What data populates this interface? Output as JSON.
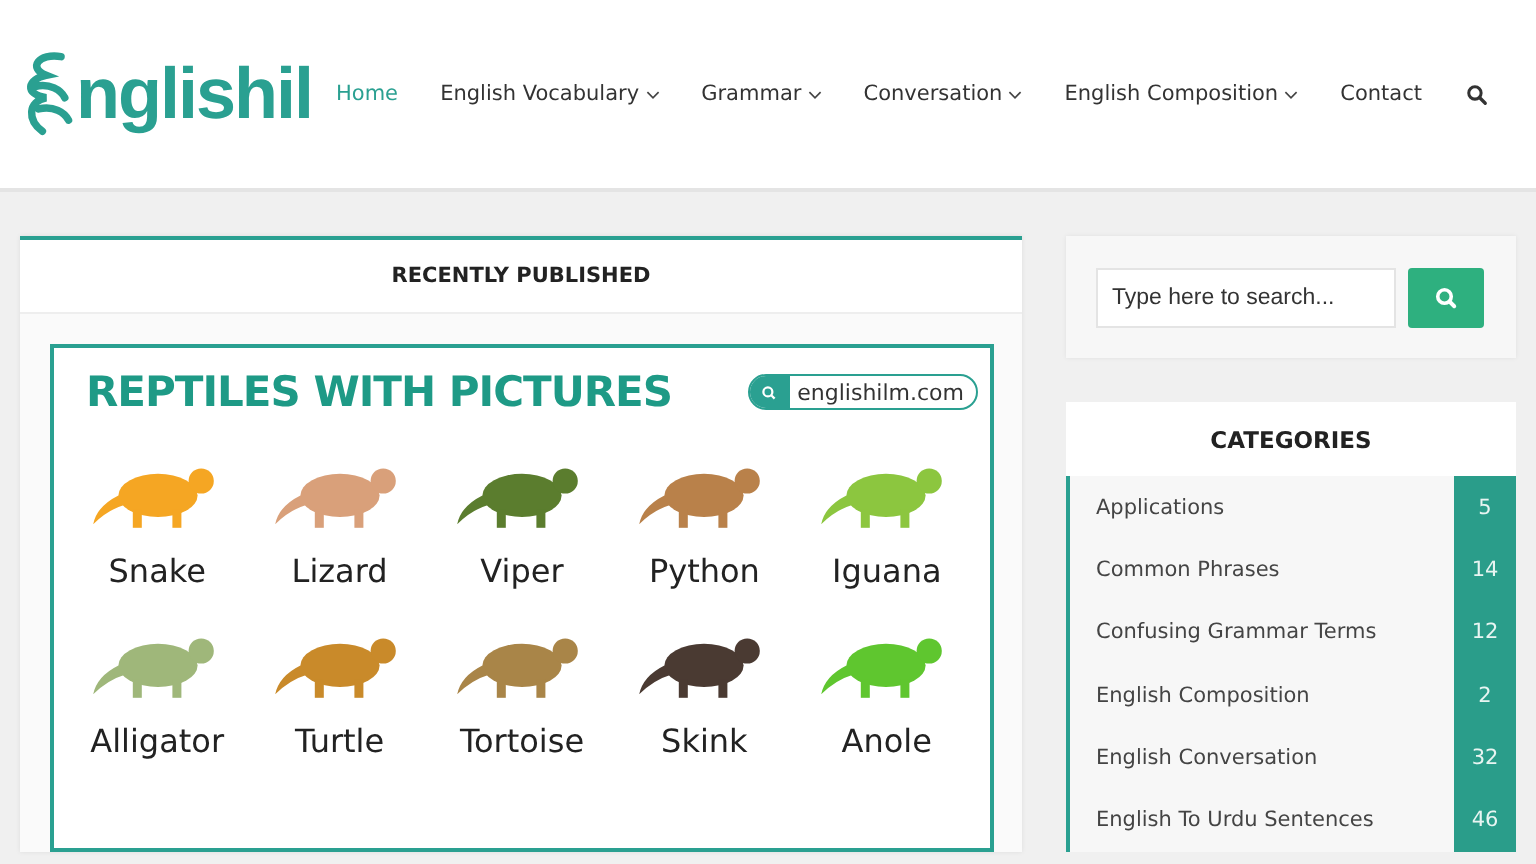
{
  "header": {
    "logo_text": "nglishil",
    "nav": [
      {
        "label": "Home",
        "selected": true,
        "dropdown": false
      },
      {
        "label": "English Vocabulary",
        "selected": false,
        "dropdown": true
      },
      {
        "label": "Grammar",
        "selected": false,
        "dropdown": true
      },
      {
        "label": "Conversation",
        "selected": false,
        "dropdown": true
      },
      {
        "label": "English Composition",
        "selected": false,
        "dropdown": true
      },
      {
        "label": "Contact",
        "selected": false,
        "dropdown": false
      }
    ]
  },
  "main": {
    "title": "RECENTLY PUBLISHED",
    "featured_image": {
      "title": "REPTILES WITH PICTURES",
      "site": "englishilm.com",
      "animals": [
        {
          "label": "Snake",
          "color": "#f5a623"
        },
        {
          "label": "Lizard",
          "color": "#d9a07a"
        },
        {
          "label": "Viper",
          "color": "#5b7d2e"
        },
        {
          "label": "Python",
          "color": "#b9814a"
        },
        {
          "label": "Iguana",
          "color": "#8cc63f"
        },
        {
          "label": "Alligator",
          "color": "#9fb77a"
        },
        {
          "label": "Turtle",
          "color": "#c98a2a"
        },
        {
          "label": "Tortoise",
          "color": "#a98548"
        },
        {
          "label": "Skink",
          "color": "#4a3a32"
        },
        {
          "label": "Anole",
          "color": "#5fc62f"
        }
      ]
    }
  },
  "sidebar": {
    "search": {
      "placeholder": "Type here to search..."
    },
    "categories": {
      "title": "CATEGORIES",
      "items": [
        {
          "name": "Applications",
          "count": "5"
        },
        {
          "name": "Common Phrases",
          "count": "14"
        },
        {
          "name": "Confusing Grammar Terms",
          "count": "12"
        },
        {
          "name": "English Composition",
          "count": "2"
        },
        {
          "name": "English Conversation",
          "count": "32"
        },
        {
          "name": "English To Urdu Sentences",
          "count": "46"
        }
      ]
    }
  }
}
